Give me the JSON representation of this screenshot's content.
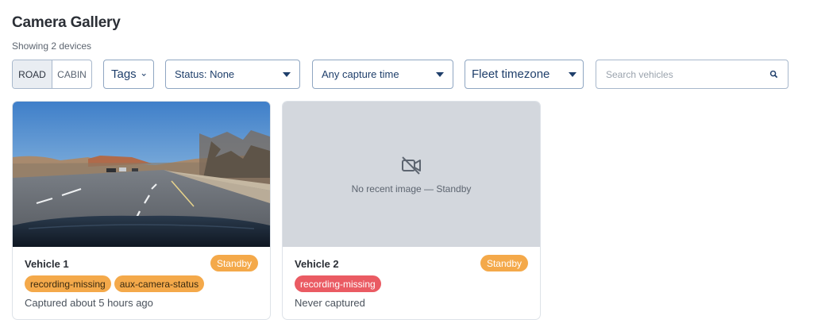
{
  "header": {
    "title": "Camera Gallery",
    "subtitle": "Showing 2 devices"
  },
  "toolbar": {
    "view_options": [
      "ROAD",
      "CABIN"
    ],
    "view_selected": "ROAD",
    "tags_label": "Tags",
    "status_label": "Status: None",
    "capture_time_label": "Any capture time",
    "timezone_label": "Fleet timezone",
    "search_placeholder": "Search vehicles"
  },
  "colors": {
    "accent": "#1f3f6b",
    "standby": "#f4a94a",
    "tag_orange": "#f4a94a",
    "tag_red": "#ea5b63"
  },
  "vehicles": [
    {
      "name": "Vehicle 1",
      "status": "Standby",
      "tags": [
        "recording-missing",
        "aux-camera-status"
      ],
      "captured": "Captured about 5 hours ago"
    },
    {
      "name": "Vehicle 2",
      "status": "Standby",
      "tags": [
        "recording-missing"
      ],
      "captured": "Never captured",
      "placeholder_text": "No recent image — Standby",
      "placeholder_icon": "video-off-icon"
    }
  ]
}
